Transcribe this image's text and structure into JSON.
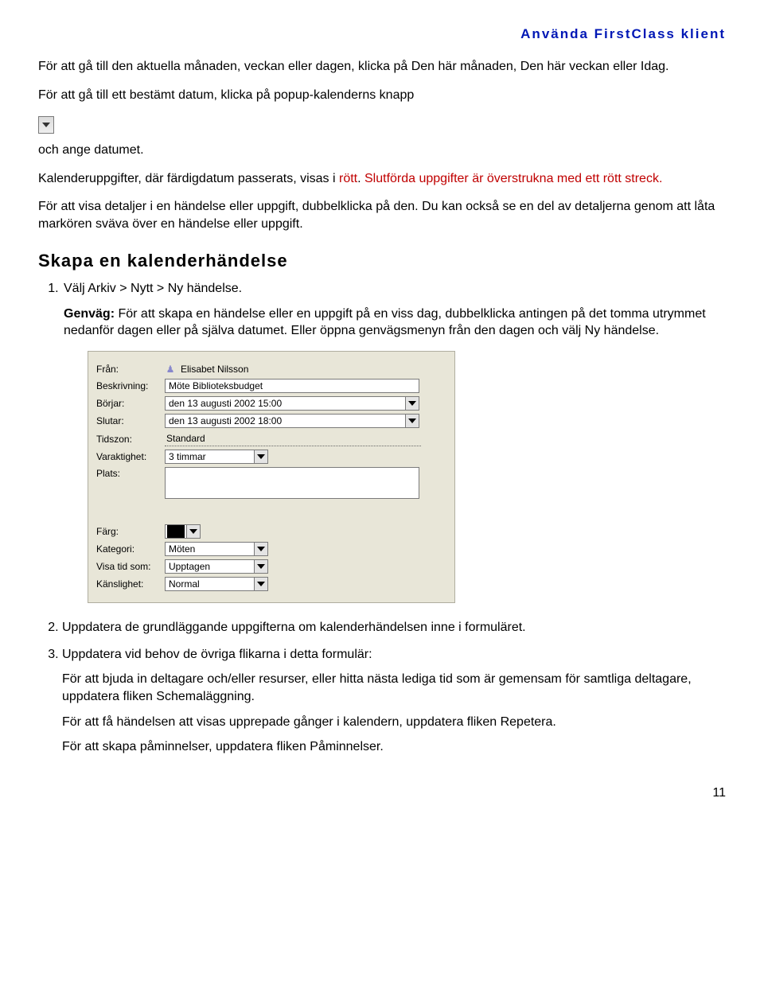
{
  "header": {
    "title": "Använda FirstClass klient"
  },
  "intro": {
    "p1": "För att gå till den aktuella månaden, veckan eller dagen, klicka på Den här månaden, Den här veckan eller Idag.",
    "p2_a": "För att gå till ett bestämt datum, klicka på popup-kalenderns knapp",
    "p2_b": "och ange datumet.",
    "p3_a": "Kalenderuppgifter, där färdigdatum passerats, visas i ",
    "p3_b": "rött",
    "p3_c": ". ",
    "p3_d": "Slutförda uppgifter är överstrukna med ett rött streck.",
    "p4": "För att visa detaljer i en händelse eller uppgift, dubbelklicka på den. Du kan också se en del av detaljerna genom att låta markören sväva över en händelse eller uppgift."
  },
  "section": {
    "title": "Skapa en kalenderhändelse"
  },
  "steps": {
    "s1": {
      "text": "Välj Arkiv > Nytt > Ny händelse.",
      "genvag_label": "Genväg: ",
      "genvag_text": "För att skapa en händelse eller en uppgift på en viss dag, dubbelklicka antingen på det tomma utrymmet nedanför dagen eller på själva datumet. Eller öppna genvägsmenyn från den dagen och välj Ny händelse."
    },
    "s2": {
      "text": "Uppdatera de grundläggande uppgifterna om kalenderhändelsen inne i formuläret."
    },
    "s3": {
      "text": "Uppdatera vid behov de övriga flikarna i detta formulär:",
      "sub1": "För att bjuda in deltagare och/eller resurser, eller hitta nästa lediga tid som är gemensam för samtliga deltagare, uppdatera fliken Schemaläggning.",
      "sub2": "För att få händelsen att visas upprepade gånger i kalendern, uppdatera fliken Repetera.",
      "sub3": "För att skapa påminnelser, uppdatera fliken Påminnelser."
    }
  },
  "form": {
    "labels": {
      "fran": "Från:",
      "beskrivning": "Beskrivning:",
      "borjar": "Börjar:",
      "slutar": "Slutar:",
      "tidszon": "Tidszon:",
      "varaktighet": "Varaktighet:",
      "plats": "Plats:",
      "farg": "Färg:",
      "kategori": "Kategori:",
      "visa_tid_som": "Visa tid som:",
      "kanslighet": "Känslighet:"
    },
    "values": {
      "fran": "Elisabet Nilsson",
      "beskrivning": "Möte Biblioteksbudget",
      "borjar": "den 13 augusti 2002 15:00",
      "slutar": "den 13 augusti 2002 18:00",
      "tidszon": "Standard",
      "varaktighet": "3 timmar",
      "plats": "",
      "farg": "#000000",
      "kategori": "Möten",
      "visa_tid_som": "Upptagen",
      "kanslighet": "Normal"
    }
  },
  "footer": {
    "page": "11"
  }
}
